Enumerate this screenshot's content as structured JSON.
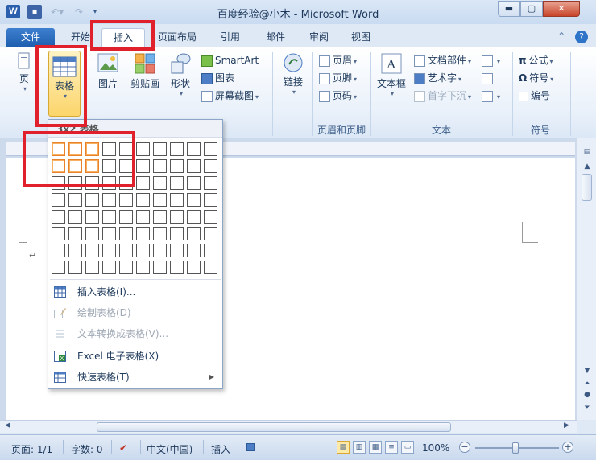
{
  "window": {
    "title": "百度经验@小木 - Microsoft Word",
    "app_icon": "W",
    "minimize_label": "▬",
    "maximize_label": "▢",
    "close_label": "✕"
  },
  "tabs": [
    "文件",
    "开始",
    "插入",
    "页面布局",
    "引用",
    "邮件",
    "审阅",
    "视图"
  ],
  "ribbon": {
    "pages_label": "页",
    "table_label": "表格",
    "picture_label": "图片",
    "clipart_label": "剪贴画",
    "shapes_label": "形状",
    "smartart_label": "SmartArt",
    "chart_label": "图表",
    "screenshot_label": "屏幕截图",
    "link_label": "链接",
    "header_label": "页眉",
    "footer_label": "页脚",
    "pagenum_label": "页码",
    "header_footer_group": "页眉和页脚",
    "textbox_label": "文本框",
    "quickparts_label": "文档部件",
    "wordart_label": "艺术字",
    "dropcap_label": "首字下沉",
    "text_group": "文本",
    "equation_label": "公式",
    "symbol_label": "符号",
    "number_label": "编号",
    "symbols_group": "符号"
  },
  "table_dropdown": {
    "header": "3x2 表格",
    "grid_cols": 10,
    "grid_rows": 8,
    "selected_cols": 3,
    "selected_rows": 2,
    "items": [
      {
        "label": "插入表格(I)...",
        "disabled": false
      },
      {
        "label": "绘制表格(D)",
        "disabled": true
      },
      {
        "label": "文本转换成表格(V)...",
        "disabled": true
      },
      {
        "label": "Excel 电子表格(X)",
        "disabled": false
      },
      {
        "label": "快速表格(T)",
        "disabled": false
      }
    ]
  },
  "statusbar": {
    "page": "页面: 1/1",
    "words": "字数: 0",
    "language": "中文(中国)",
    "mode": "插入",
    "zoom": "100%"
  },
  "colors": {
    "highlight": "#e0202a",
    "file_tab": "#1f5fb0",
    "grid_selected": "#e8822c"
  }
}
